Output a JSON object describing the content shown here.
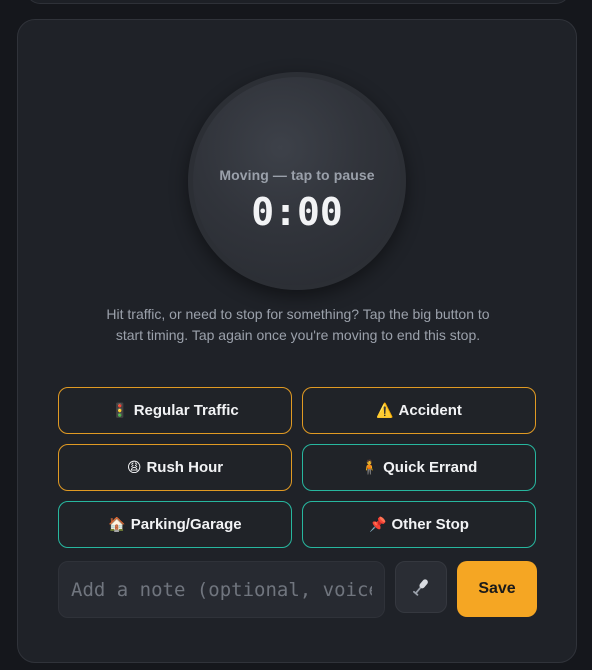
{
  "timer": {
    "status": "Moving — tap to pause",
    "time": "0:00"
  },
  "hint": "Hit traffic, or need to stop for something? Tap the big button to start timing. Tap again once you're moving to end this stop.",
  "categories": [
    {
      "label": "Regular Traffic",
      "icon": "traffic-light-icon",
      "emoji": "🚦",
      "accent": "#e09a23"
    },
    {
      "label": "Accident",
      "icon": "warning-icon",
      "emoji": "⚠️",
      "accent": "#e09a23"
    },
    {
      "label": "Rush Hour",
      "icon": "person-icon",
      "emoji": "😩",
      "accent": "#e09a23"
    },
    {
      "label": "Quick Errand",
      "icon": "walking-person-icon",
      "emoji": "🧍",
      "accent": "#27b79f"
    },
    {
      "label": "Parking/Garage",
      "icon": "building-icon",
      "emoji": "🏠",
      "accent": "#27b79f"
    },
    {
      "label": "Other Stop",
      "icon": "pushpin-icon",
      "emoji": "📌",
      "accent": "#27b79f"
    }
  ],
  "note": {
    "placeholder": "Add a note (optional, voice ok)",
    "value": ""
  },
  "save_label": "Save",
  "colors": {
    "accent_orange": "#f5a623",
    "border_orange": "#e09a23",
    "border_teal": "#27b79f",
    "card_bg": "#1f2228"
  }
}
